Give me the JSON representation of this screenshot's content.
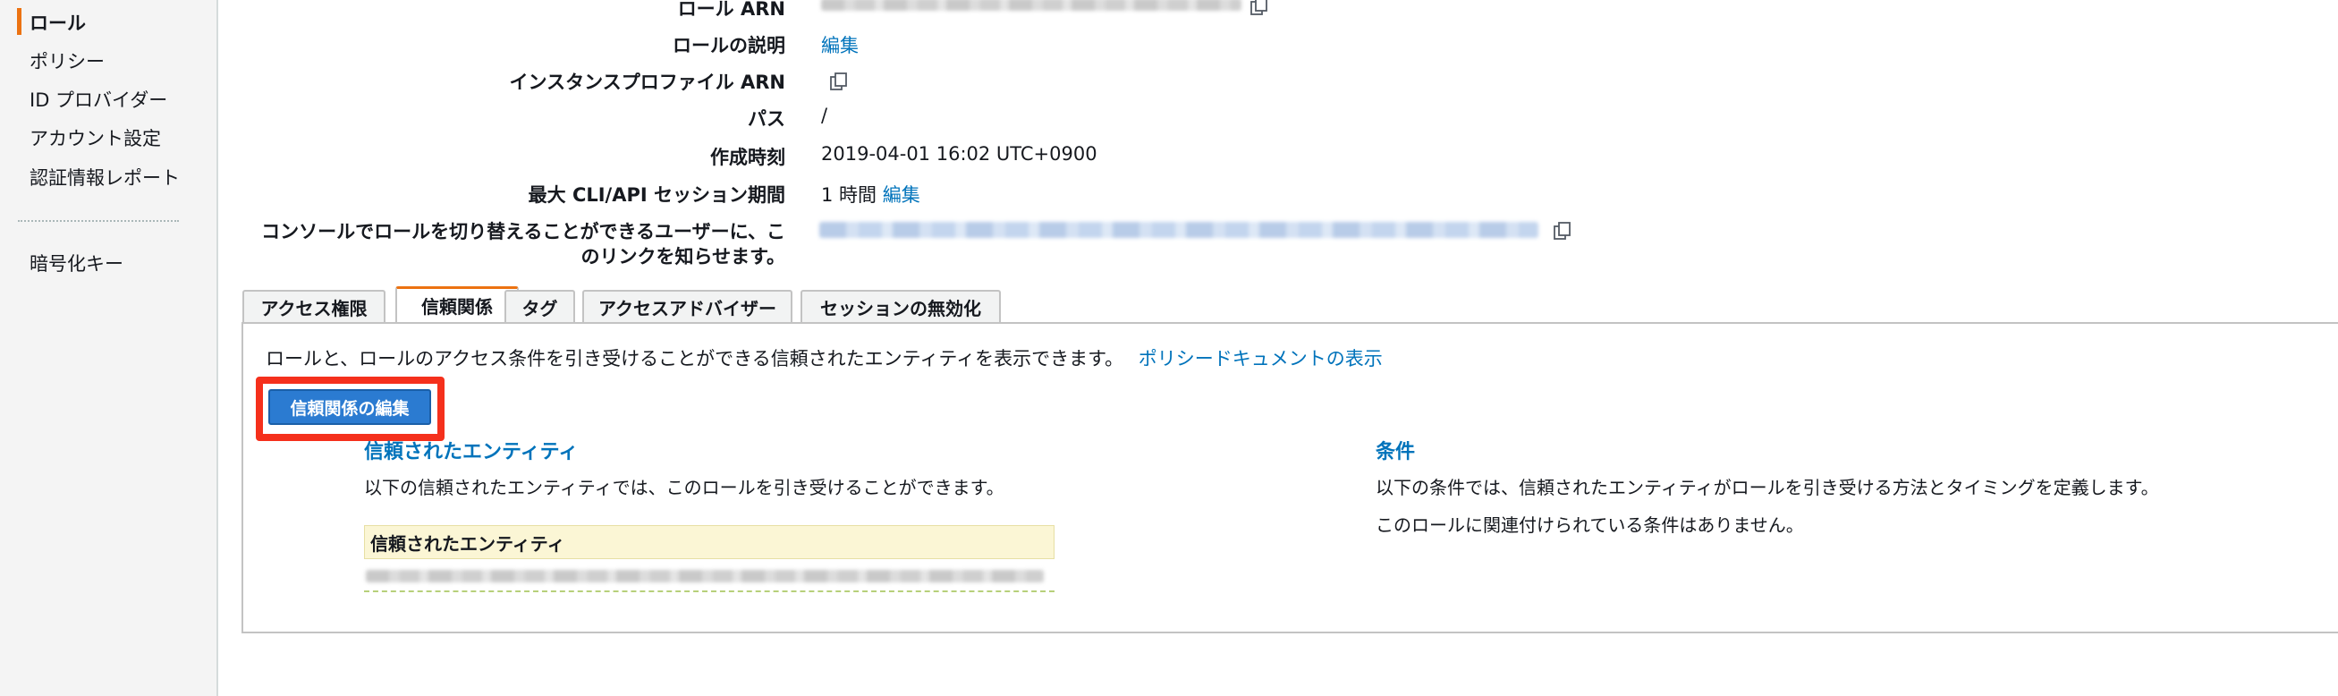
{
  "sidebar": {
    "items": [
      {
        "label": "ロール",
        "active": true
      },
      {
        "label": "ポリシー"
      },
      {
        "label": "ID プロバイダー"
      },
      {
        "label": "アカウント設定"
      },
      {
        "label": "認証情報レポート"
      }
    ],
    "secondary_items": [
      {
        "label": "暗号化キー"
      }
    ]
  },
  "summary": {
    "role_arn_label": "ロール ARN",
    "role_description_label": "ロールの説明",
    "role_description_edit": "編集",
    "instance_profile_arn_label": "インスタンスプロファイル ARN",
    "path_label": "パス",
    "path_value": "/",
    "creation_time_label": "作成時刻",
    "creation_time_value": "2019-04-01 16:02 UTC+0900",
    "max_session_label": "最大 CLI/API セッション期間",
    "max_session_value": "1 時間",
    "max_session_edit": "編集",
    "switch_role_label_line1": "コンソールでロールを切り替えることができるユーザーに、こ",
    "switch_role_label_line2": "のリンクを知らせます。"
  },
  "tabs": [
    {
      "label": "アクセス権限"
    },
    {
      "label": "信頼関係",
      "active": true
    },
    {
      "label": "タグ"
    },
    {
      "label": "アクセスアドバイザー"
    },
    {
      "label": "セッションの無効化"
    }
  ],
  "trust": {
    "description": "ロールと、ロールのアクセス条件を引き受けることができる信頼されたエンティティを表示できます。",
    "policy_doc_link": "ポリシードキュメントの表示",
    "edit_button": "信頼関係の編集",
    "entities_title": "信頼されたエンティティ",
    "entities_text": "以下の信頼されたエンティティでは、このロールを引き受けることができます。",
    "entities_table_header": "信頼されたエンティティ",
    "conditions_title": "条件",
    "conditions_text": "以下の条件では、信頼されたエンティティがロールを引き受ける方法とタイミングを定義します。",
    "conditions_empty": "このロールに関連付けられている条件はありません。"
  },
  "colors": {
    "accent": "#ec7211",
    "link": "#0073bb",
    "primary_button": "#2b7bd1",
    "highlight_box": "#f5301c"
  }
}
